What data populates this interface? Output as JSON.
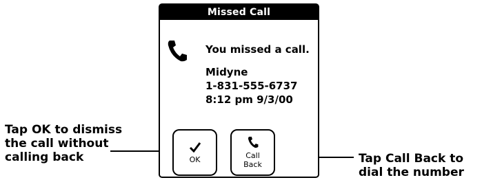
{
  "dialog": {
    "title": "Missed Call",
    "message": "You missed a call.",
    "caller_name": "Midyne",
    "caller_number": "1-831-555-6737",
    "timestamp": "8:12 pm 9/3/00",
    "icons": {
      "phone": "phone-icon",
      "check": "checkmark-icon"
    },
    "buttons": {
      "ok_label": "OK",
      "call_back_label_1": "Call",
      "call_back_label_2": "Back"
    }
  },
  "callouts": {
    "left_line1": "Tap OK to dismiss",
    "left_line2": "the call without",
    "left_line3": "calling back",
    "right_line1": "Tap Call Back to",
    "right_line2": "dial the number"
  }
}
